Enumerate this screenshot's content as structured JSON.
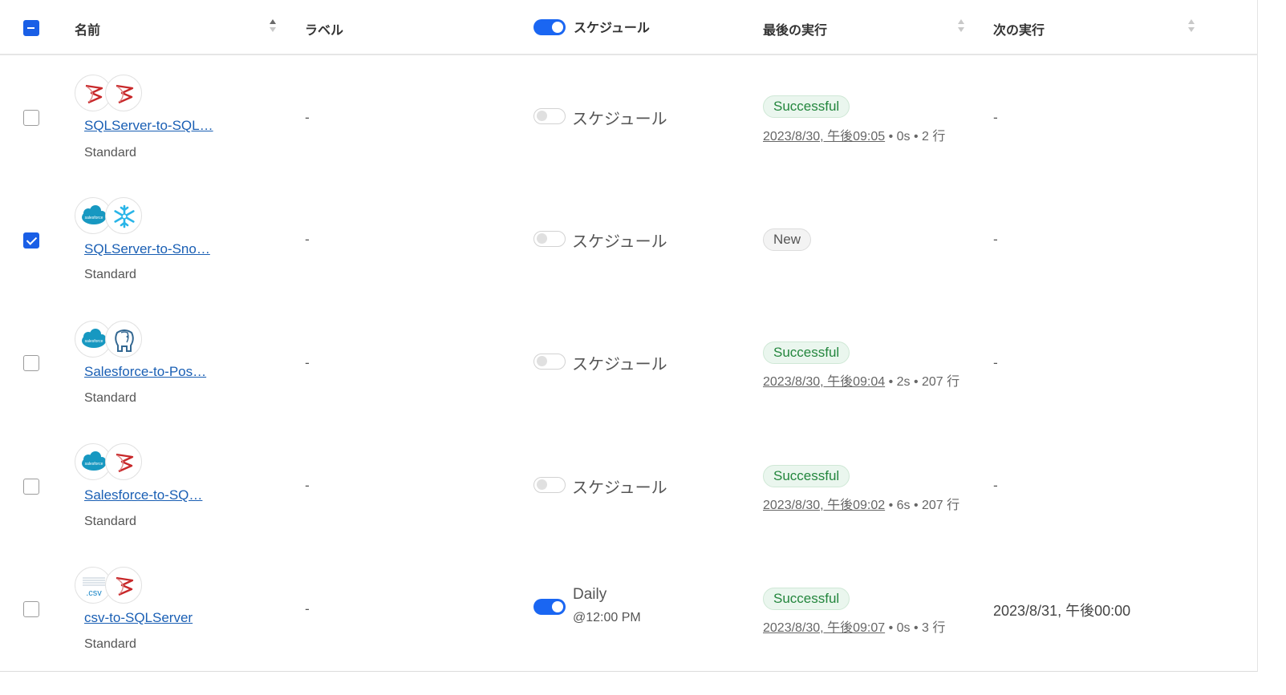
{
  "header": {
    "name": "名前",
    "label": "ラベル",
    "schedule": "スケジュール",
    "last_run": "最後の実行",
    "next_run": "次の実行"
  },
  "rows": [
    {
      "checked": false,
      "icons": [
        "sqlserver-icon",
        "sqlserver-icon"
      ],
      "name": "SQLServer-to-SQL…",
      "edition": "Standard",
      "label": "-",
      "schedule_on": false,
      "schedule_label": "スケジュール",
      "status": "Successful",
      "run_time": "2023/8/30, 午後09:05",
      "run_rest": " • 0s • 2 行",
      "next_run": "-"
    },
    {
      "checked": true,
      "icons": [
        "salesforce-icon",
        "snowflake-icon"
      ],
      "name": "SQLServer-to-Sno…",
      "edition": "Standard",
      "label": "-",
      "schedule_on": false,
      "schedule_label": "スケジュール",
      "status": "New",
      "run_time": "",
      "run_rest": "",
      "next_run": "-"
    },
    {
      "checked": false,
      "icons": [
        "salesforce-icon",
        "postgresql-icon"
      ],
      "name": "Salesforce-to-Pos…",
      "edition": "Standard",
      "label": "-",
      "schedule_on": false,
      "schedule_label": "スケジュール",
      "status": "Successful",
      "run_time": "2023/8/30, 午後09:04",
      "run_rest": " • 2s • 207 行",
      "next_run": "-"
    },
    {
      "checked": false,
      "icons": [
        "salesforce-icon",
        "sqlserver-icon"
      ],
      "name": "Salesforce-to-SQ…",
      "edition": "Standard",
      "label": "-",
      "schedule_on": false,
      "schedule_label": "スケジュール",
      "status": "Successful",
      "run_time": "2023/8/30, 午後09:02",
      "run_rest": " • 6s • 207 行",
      "next_run": "-"
    },
    {
      "checked": false,
      "icons": [
        "csv-icon",
        "sqlserver-icon"
      ],
      "name": "csv-to-SQLServer",
      "edition": "Standard",
      "label": "-",
      "schedule_on": true,
      "schedule_label": "Daily",
      "schedule_time": "@12:00 PM",
      "status": "Successful",
      "run_time": "2023/8/30, 午後09:07",
      "run_rest": " • 0s • 3 行",
      "next_run": "2023/8/31, 午後00:00"
    }
  ],
  "icon_labels": {
    "salesforce": "salesforce",
    "csv": ".csv"
  },
  "colors": {
    "accent": "#1a66f2",
    "success_text": "#23863d",
    "success_bg": "#eaf6ee",
    "link": "#1a5fb4",
    "sqlserver_red": "#c8282a",
    "salesforce_blue": "#1798c1",
    "snowflake_blue": "#29b5e8",
    "postgres_blue": "#336791"
  }
}
